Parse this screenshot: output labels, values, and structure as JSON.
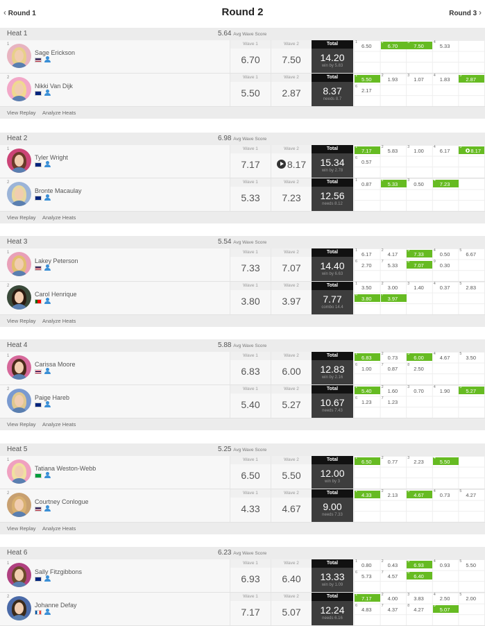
{
  "nav": {
    "prev_label": "Round 1",
    "title": "Round 2",
    "next_label": "Round 3"
  },
  "avg_label": "Avg Wave Score",
  "footer": {
    "replay": "View Replay",
    "analyze": "Analyze Heats"
  },
  "colors": {
    "highlight": "#66bb22",
    "total_bg": "#3d3d3d",
    "total_header": "#111111"
  },
  "heats": [
    {
      "name": "Heat 1",
      "avg": "5.64",
      "surfers": [
        {
          "seed": "1",
          "name": "Sage Erickson",
          "country": "USA",
          "wave1_label": "Wave 1",
          "wave2_label": "Wave 2",
          "total_label": "Total",
          "wave1": "6.70",
          "wave2": "7.50",
          "total": "14.20",
          "status": "win by 5.83",
          "wave2_video": false,
          "scores": [
            {
              "n": "1",
              "s": "6.50",
              "hl": false,
              "video": false
            },
            {
              "n": "2",
              "s": "6.70",
              "hl": true,
              "video": false
            },
            {
              "n": "3",
              "s": "7.50",
              "hl": true,
              "video": false
            },
            {
              "n": "4",
              "s": "5.33",
              "hl": false,
              "video": false
            }
          ]
        },
        {
          "seed": "2",
          "name": "Nikki Van Dijk",
          "country": "AUS",
          "wave1_label": "Wave 1",
          "wave2_label": "Wave 2",
          "total_label": "Total",
          "wave1": "5.50",
          "wave2": "2.87",
          "total": "8.37",
          "status": "needs 8.7",
          "wave2_video": false,
          "scores": [
            {
              "n": "1",
              "s": "5.50",
              "hl": true,
              "video": false
            },
            {
              "n": "2",
              "s": "1.93",
              "hl": false,
              "video": false
            },
            {
              "n": "3",
              "s": "1.07",
              "hl": false,
              "video": false
            },
            {
              "n": "4",
              "s": "1.83",
              "hl": false,
              "video": false
            },
            {
              "n": "5",
              "s": "2.87",
              "hl": true,
              "video": false
            },
            {
              "n": "6",
              "s": "2.17",
              "hl": false,
              "video": false
            }
          ]
        }
      ]
    },
    {
      "name": "Heat 2",
      "avg": "6.98",
      "surfers": [
        {
          "seed": "1",
          "name": "Tyler Wright",
          "country": "AUS",
          "wave1_label": "Wave 1",
          "wave2_label": "Wave 2",
          "total_label": "Total",
          "wave1": "7.17",
          "wave2": "8.17",
          "total": "15.34",
          "status": "win by 2.78",
          "wave2_video": true,
          "scores": [
            {
              "n": "1",
              "s": "7.17",
              "hl": true,
              "video": false
            },
            {
              "n": "2",
              "s": "5.83",
              "hl": false,
              "video": false
            },
            {
              "n": "3",
              "s": "1.00",
              "hl": false,
              "video": false
            },
            {
              "n": "4",
              "s": "6.17",
              "hl": false,
              "video": false
            },
            {
              "n": "5",
              "s": "8.17",
              "hl": true,
              "video": true
            },
            {
              "n": "6",
              "s": "0.57",
              "hl": false,
              "video": false
            }
          ]
        },
        {
          "seed": "2",
          "name": "Bronte Macaulay",
          "country": "AUS",
          "wave1_label": "Wave 1",
          "wave2_label": "Wave 2",
          "total_label": "Total",
          "wave1": "5.33",
          "wave2": "7.23",
          "total": "12.56",
          "status": "needs 8.12",
          "wave2_video": false,
          "scores": [
            {
              "n": "1",
              "s": "0.87",
              "hl": false,
              "video": false
            },
            {
              "n": "2",
              "s": "5.33",
              "hl": true,
              "video": false
            },
            {
              "n": "3",
              "s": "0.50",
              "hl": false,
              "video": false
            },
            {
              "n": "4",
              "s": "7.23",
              "hl": true,
              "video": false
            }
          ]
        }
      ]
    },
    {
      "name": "Heat 3",
      "avg": "5.54",
      "surfers": [
        {
          "seed": "1",
          "name": "Lakey Peterson",
          "country": "USA",
          "wave1_label": "Wave 1",
          "wave2_label": "Wave 2",
          "total_label": "Total",
          "wave1": "7.33",
          "wave2": "7.07",
          "total": "14.40",
          "status": "win by 6.63",
          "wave2_video": false,
          "scores": [
            {
              "n": "1",
              "s": "6.17",
              "hl": false,
              "video": false
            },
            {
              "n": "2",
              "s": "4.17",
              "hl": false,
              "video": false
            },
            {
              "n": "3",
              "s": "7.33",
              "hl": true,
              "video": false
            },
            {
              "n": "4",
              "s": "0.50",
              "hl": false,
              "video": false
            },
            {
              "n": "5",
              "s": "6.67",
              "hl": false,
              "video": false
            },
            {
              "n": "6",
              "s": "2.70",
              "hl": false,
              "video": false
            },
            {
              "n": "7",
              "s": "5.33",
              "hl": false,
              "video": false
            },
            {
              "n": "8",
              "s": "7.07",
              "hl": true,
              "video": false
            },
            {
              "n": "9",
              "s": "0.30",
              "hl": false,
              "video": false
            }
          ]
        },
        {
          "seed": "2",
          "name": "Carol Henrique",
          "country": "POR",
          "wave1_label": "Wave 1",
          "wave2_label": "Wave 2",
          "total_label": "Total",
          "wave1": "3.80",
          "wave2": "3.97",
          "total": "7.77",
          "status": "combo 14.4",
          "wave2_video": false,
          "scores": [
            {
              "n": "1",
              "s": "3.50",
              "hl": false,
              "video": false
            },
            {
              "n": "2",
              "s": "3.00",
              "hl": false,
              "video": false
            },
            {
              "n": "3",
              "s": "1.40",
              "hl": false,
              "video": false
            },
            {
              "n": "4",
              "s": "0.37",
              "hl": false,
              "video": false
            },
            {
              "n": "5",
              "s": "2.83",
              "hl": false,
              "video": false
            },
            {
              "n": "6",
              "s": "3.80",
              "hl": true,
              "video": false
            },
            {
              "n": "7",
              "s": "3.97",
              "hl": true,
              "video": false
            }
          ]
        }
      ]
    },
    {
      "name": "Heat 4",
      "avg": "5.88",
      "surfers": [
        {
          "seed": "1",
          "name": "Carissa Moore",
          "country": "HAW",
          "wave1_label": "Wave 1",
          "wave2_label": "Wave 2",
          "total_label": "Total",
          "wave1": "6.83",
          "wave2": "6.00",
          "total": "12.83",
          "status": "win by 2.16",
          "wave2_video": false,
          "scores": [
            {
              "n": "1",
              "s": "6.83",
              "hl": true,
              "video": false
            },
            {
              "n": "2",
              "s": "0.73",
              "hl": false,
              "video": false
            },
            {
              "n": "3",
              "s": "6.00",
              "hl": true,
              "video": false
            },
            {
              "n": "4",
              "s": "4.67",
              "hl": false,
              "video": false
            },
            {
              "n": "5",
              "s": "3.50",
              "hl": false,
              "video": false
            },
            {
              "n": "6",
              "s": "1.00",
              "hl": false,
              "video": false
            },
            {
              "n": "7",
              "s": "0.87",
              "hl": false,
              "video": false
            },
            {
              "n": "8",
              "s": "2.50",
              "hl": false,
              "video": false
            }
          ]
        },
        {
          "seed": "2",
          "name": "Paige Hareb",
          "country": "NZL",
          "wave1_label": "Wave 1",
          "wave2_label": "Wave 2",
          "total_label": "Total",
          "wave1": "5.40",
          "wave2": "5.27",
          "total": "10.67",
          "status": "needs 7.43",
          "wave2_video": false,
          "scores": [
            {
              "n": "1",
              "s": "5.40",
              "hl": true,
              "video": false
            },
            {
              "n": "2",
              "s": "1.60",
              "hl": false,
              "video": false
            },
            {
              "n": "3",
              "s": "0.70",
              "hl": false,
              "video": false
            },
            {
              "n": "4",
              "s": "1.90",
              "hl": false,
              "video": false
            },
            {
              "n": "5",
              "s": "5.27",
              "hl": true,
              "video": false
            },
            {
              "n": "6",
              "s": "1.23",
              "hl": false,
              "video": false
            },
            {
              "n": "7",
              "s": "1.23",
              "hl": false,
              "video": false
            }
          ]
        }
      ]
    },
    {
      "name": "Heat 5",
      "avg": "5.25",
      "surfers": [
        {
          "seed": "1",
          "name": "Tatiana Weston-Webb",
          "country": "BRA",
          "wave1_label": "Wave 1",
          "wave2_label": "Wave 2",
          "total_label": "Total",
          "wave1": "6.50",
          "wave2": "5.50",
          "total": "12.00",
          "status": "win by 3",
          "wave2_video": false,
          "scores": [
            {
              "n": "1",
              "s": "6.50",
              "hl": true,
              "video": false
            },
            {
              "n": "2",
              "s": "0.77",
              "hl": false,
              "video": false
            },
            {
              "n": "3",
              "s": "2.23",
              "hl": false,
              "video": false
            },
            {
              "n": "4",
              "s": "5.50",
              "hl": true,
              "video": false
            }
          ]
        },
        {
          "seed": "2",
          "name": "Courtney Conlogue",
          "country": "USA",
          "wave1_label": "Wave 1",
          "wave2_label": "Wave 2",
          "total_label": "Total",
          "wave1": "4.33",
          "wave2": "4.67",
          "total": "9.00",
          "status": "needs 7.33",
          "wave2_video": false,
          "scores": [
            {
              "n": "1",
              "s": "4.33",
              "hl": true,
              "video": false
            },
            {
              "n": "2",
              "s": "2.13",
              "hl": false,
              "video": false
            },
            {
              "n": "3",
              "s": "4.67",
              "hl": true,
              "video": false
            },
            {
              "n": "4",
              "s": "0.73",
              "hl": false,
              "video": false
            },
            {
              "n": "5",
              "s": "4.27",
              "hl": false,
              "video": false
            }
          ]
        }
      ]
    },
    {
      "name": "Heat 6",
      "avg": "6.23",
      "surfers": [
        {
          "seed": "1",
          "name": "Sally Fitzgibbons",
          "country": "AUS",
          "wave1_label": "Wave 1",
          "wave2_label": "Wave 2",
          "total_label": "Total",
          "wave1": "6.93",
          "wave2": "6.40",
          "total": "13.33",
          "status": "win by 1.09",
          "wave2_video": false,
          "scores": [
            {
              "n": "1",
              "s": "0.80",
              "hl": false,
              "video": false
            },
            {
              "n": "2",
              "s": "0.43",
              "hl": false,
              "video": false
            },
            {
              "n": "3",
              "s": "6.93",
              "hl": true,
              "video": false
            },
            {
              "n": "4",
              "s": "0.93",
              "hl": false,
              "video": false
            },
            {
              "n": "5",
              "s": "5.50",
              "hl": false,
              "video": false
            },
            {
              "n": "6",
              "s": "5.73",
              "hl": false,
              "video": false
            },
            {
              "n": "7",
              "s": "4.57",
              "hl": false,
              "video": false
            },
            {
              "n": "8",
              "s": "6.40",
              "hl": true,
              "video": false
            }
          ]
        },
        {
          "seed": "2",
          "name": "Johanne Defay",
          "country": "FRA",
          "wave1_label": "Wave 1",
          "wave2_label": "Wave 2",
          "total_label": "Total",
          "wave1": "7.17",
          "wave2": "5.07",
          "total": "12.24",
          "status": "needs 6.16",
          "wave2_video": false,
          "scores": [
            {
              "n": "1",
              "s": "7.17",
              "hl": true,
              "video": false
            },
            {
              "n": "2",
              "s": "4.00",
              "hl": false,
              "video": false
            },
            {
              "n": "3",
              "s": "3.83",
              "hl": false,
              "video": false
            },
            {
              "n": "4",
              "s": "2.50",
              "hl": false,
              "video": false
            },
            {
              "n": "5",
              "s": "2.00",
              "hl": false,
              "video": false
            },
            {
              "n": "6",
              "s": "4.83",
              "hl": false,
              "video": false
            },
            {
              "n": "7",
              "s": "4.37",
              "hl": false,
              "video": false
            },
            {
              "n": "8",
              "s": "4.27",
              "hl": false,
              "video": false
            },
            {
              "n": "9",
              "s": "5.07",
              "hl": true,
              "video": false
            }
          ]
        }
      ]
    }
  ]
}
